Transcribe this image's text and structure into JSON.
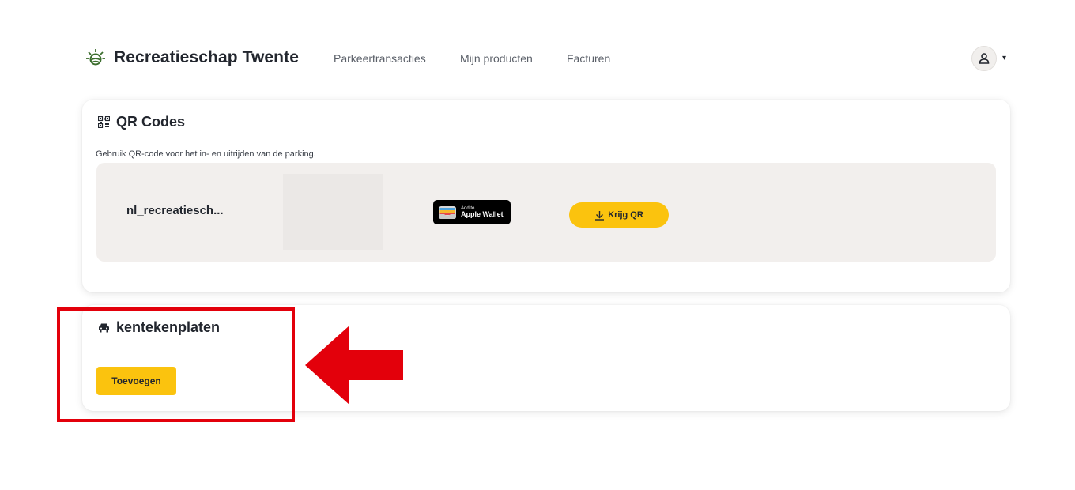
{
  "brand": {
    "name": "Recreatieschap Twente"
  },
  "nav": {
    "links": [
      {
        "label": "Parkeertransacties"
      },
      {
        "label": "Mijn producten"
      },
      {
        "label": "Facturen"
      }
    ]
  },
  "user_menu": {
    "icon": "user-icon",
    "caret": "▾"
  },
  "qr_card": {
    "icon": "qr-icon",
    "title": "QR Codes",
    "description": "Gebruik QR-code voor het in- en uitrijden van de parking.",
    "item": {
      "name": "nl_recreatiesch...",
      "wallet_small": "Add to",
      "wallet_big": "Apple Wallet",
      "qr_button": "Krijg QR"
    }
  },
  "plates_card": {
    "icon": "car-icon",
    "title": "kentekenplaten",
    "add_button": "Toevoegen"
  },
  "colors": {
    "accent": "#fbc30e",
    "annotation": "#e3000b",
    "panel": "#f2efed",
    "text": "#22262e"
  }
}
